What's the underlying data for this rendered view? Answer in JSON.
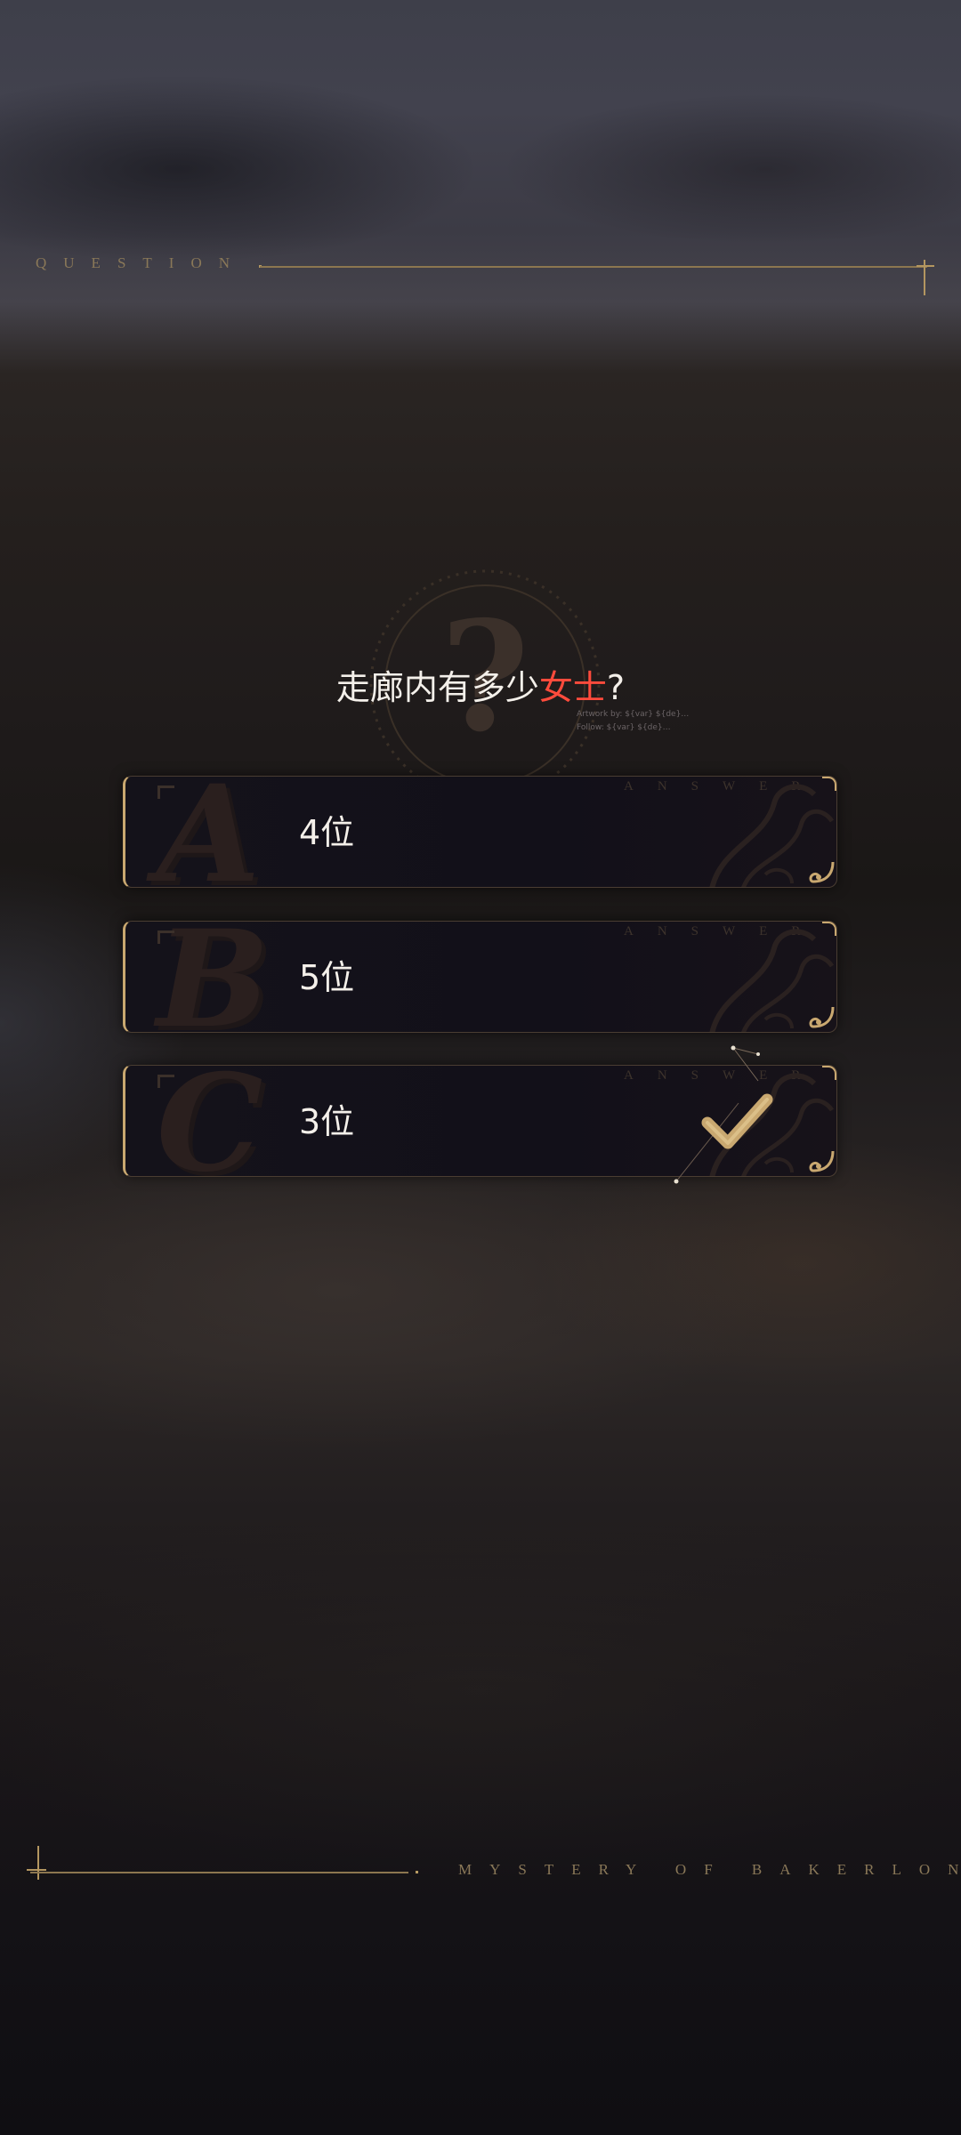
{
  "header": {
    "overlay_title": "QUESTION"
  },
  "question": {
    "prefix": "走廊内有多少",
    "highlight": "女士",
    "suffix": "?"
  },
  "emblem_credit": {
    "line1": "Artwork by: ${var} ${de}…",
    "line2": "Follow: ${var} ${de}…"
  },
  "options": [
    {
      "letter": "A",
      "label": "4位",
      "tag": "ANSWER",
      "selected": false
    },
    {
      "letter": "B",
      "label": "5位",
      "tag": "ANSWER",
      "selected": false
    },
    {
      "letter": "C",
      "label": "3位",
      "tag": "ANSWER",
      "selected": true
    }
  ],
  "footer": {
    "brand": "MYSTERY OF BAKERLON"
  },
  "colors": {
    "gold": "#c9a870",
    "highlight": "#ff4b3c",
    "text": "#f4f0ea"
  },
  "icons": {
    "emblem": "question-mark-emblem-icon",
    "check": "check-mark-icon"
  }
}
